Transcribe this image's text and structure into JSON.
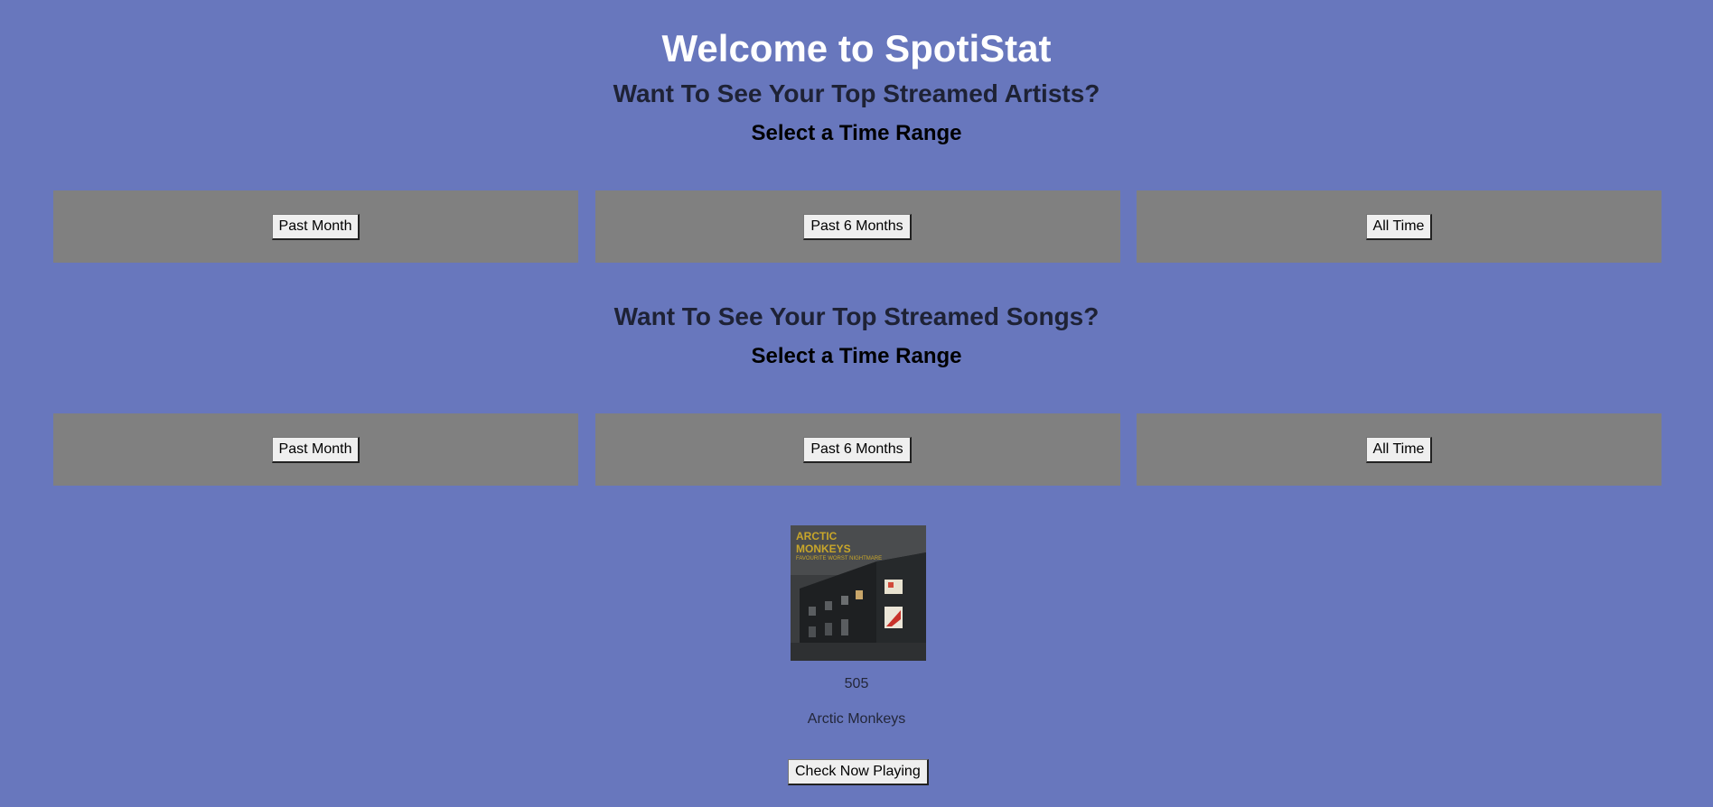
{
  "header": {
    "title": "Welcome to SpotiStat"
  },
  "artists": {
    "heading": "Want To See Your Top Streamed Artists?",
    "range_label": "Select a Time Range",
    "buttons": [
      "Past Month",
      "Past 6 Months",
      "All Time"
    ]
  },
  "songs": {
    "heading": "Want To See Your Top Streamed Songs?",
    "range_label": "Select a Time Range",
    "buttons": [
      "Past Month",
      "Past 6 Months",
      "All Time"
    ]
  },
  "now_playing": {
    "track": "505",
    "artist": "Arctic Monkeys",
    "check_button": "Check Now Playing"
  },
  "colors": {
    "background": "#6877bd",
    "panel": "#808080",
    "title": "#ffffff"
  }
}
